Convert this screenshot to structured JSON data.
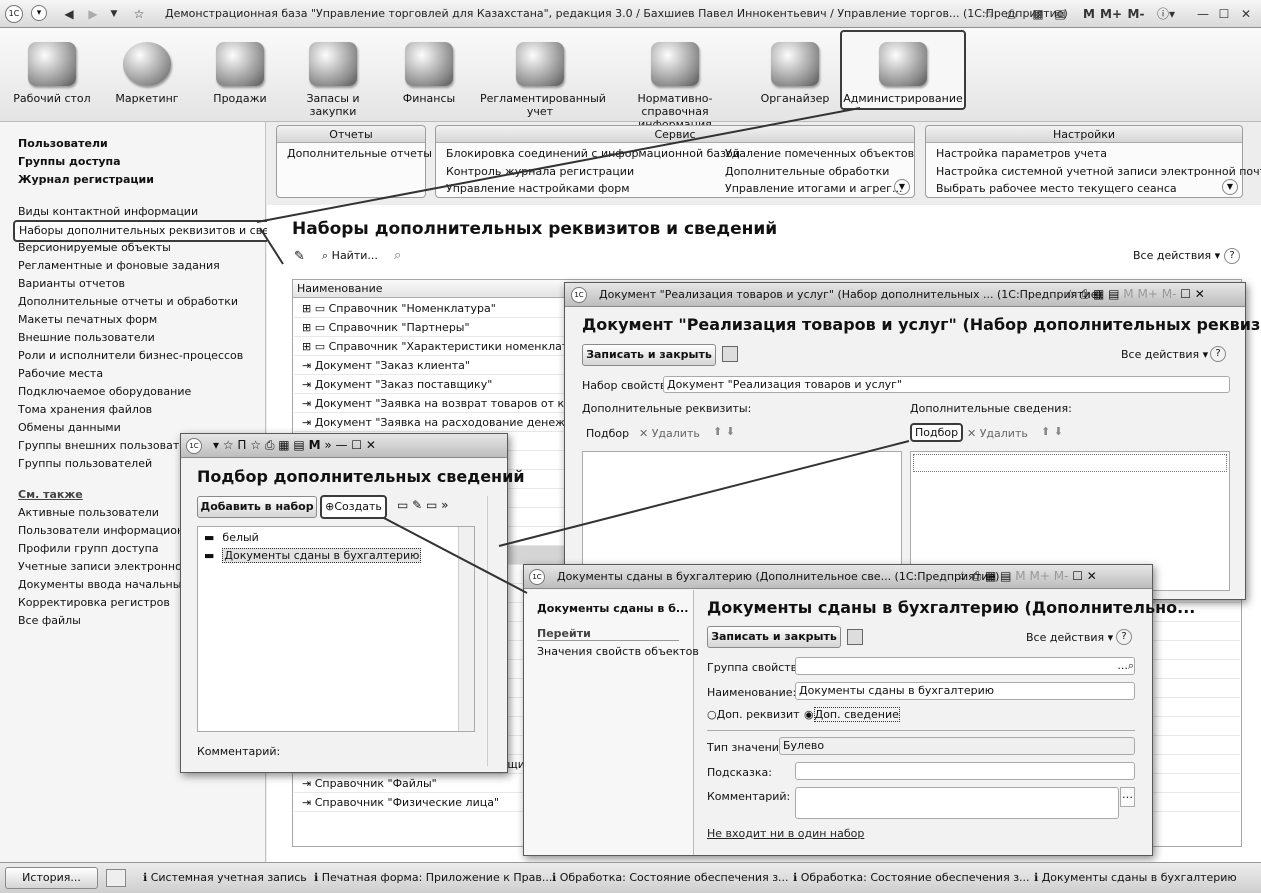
{
  "window": {
    "title": "Демонстрационная база \"Управление торговлей для Казахстана\", редакция 3.0 / Бахшиев Павел Иннокентьевич / Управление торгов...  (1С:Предприятие)",
    "m_buttons": [
      "M",
      "M+",
      "M-"
    ]
  },
  "sections": [
    {
      "label": "Рабочий стол",
      "icon": "desktop-icon"
    },
    {
      "label": "Маркетинг",
      "icon": "pie-chart-icon"
    },
    {
      "label": "Продажи",
      "icon": "truck-icon"
    },
    {
      "label": "Запасы и закупки",
      "icon": "boxes-icon"
    },
    {
      "label": "Финансы",
      "icon": "coins-icon"
    },
    {
      "label": "Регламентированный учет",
      "icon": "document-icon"
    },
    {
      "label": "Нормативно-справочная информация",
      "icon": "binders-icon"
    },
    {
      "label": "Органайзер",
      "icon": "clipboard-icon"
    },
    {
      "label": "Администрирование",
      "icon": "computer-icon"
    }
  ],
  "sidebar": {
    "bold_items": [
      "Пользователи",
      "Группы доступа",
      "Журнал регистрации"
    ],
    "items": [
      "Виды контактной информации",
      "Наборы дополнительных реквизитов и свед...",
      "Версионируемые объекты",
      "Регламентные и фоновые задания",
      "Варианты отчетов",
      "Дополнительные отчеты и обработки",
      "Макеты печатных форм",
      "Внешние пользователи",
      "Роли и исполнители бизнес-процессов",
      "Рабочие места",
      "Подключаемое оборудование",
      "Тома хранения файлов",
      "Обмены данными",
      "Группы внешних пользователей",
      "Группы пользователей"
    ],
    "see_also": "См. также",
    "see_items": [
      "Активные пользователи",
      "Пользователи информационной",
      "Профили групп доступа",
      "Учетные записи электронной п",
      "Документы ввода начальных ос",
      "Корректировка регистров",
      "Все файлы"
    ]
  },
  "panels": {
    "reports": {
      "title": "Отчеты",
      "items": [
        "Дополнительные отчеты"
      ]
    },
    "service": {
      "title": "Сервис",
      "col1": [
        "Блокировка соединений с информационной базой",
        "Контроль журнала регистрации",
        "Управление настройками форм"
      ],
      "col2": [
        "Удаление помеченных объектов",
        "Дополнительные обработки",
        "Управление итогами и агрег..."
      ]
    },
    "settings": {
      "title": "Настройки",
      "items": [
        "Настройка параметров учета",
        "Настройка системной учетной записи электронной почты",
        "Выбрать рабочее место текущего сеанса"
      ]
    }
  },
  "main": {
    "title": "Наборы дополнительных реквизитов и сведений",
    "find": "Найти...",
    "all_actions": "Все действия",
    "col_name": "Наименование",
    "rows": [
      "Справочник \"Номенклатура\"",
      "Справочник \"Партнеры\"",
      "Справочник \"Характеристики номенклатуры\"",
      "Документ \"Заказ клиента\"",
      "Документ \"Заказ поставщику\"",
      "Документ \"Заявка на возврат товаров от кли",
      "Документ \"Заявка на расходование денежн",
      "жение клие",
      "в\"",
      "",
      "",
      "и услуг\"",
      "инвентари",
      "услуг\"",
      "",
      "",
      "",
      "",
      "",
      "",
      "",
      "",
      "тгам",
      "",
      "Справочник \"Условия цен поставщи",
      "Справочник \"Файлы\"",
      "Справочник \"Физические лица\""
    ]
  },
  "doc_window": {
    "title": "Документ \"Реализация товаров и услуг\" (Набор дополнительных ...  (1С:Предприятие)",
    "heading": "Документ \"Реализация товаров и услуг\" (Набор дополнительных реквизито...",
    "save_close": "Записать и закрыть",
    "all_actions": "Все действия",
    "set_label": "Набор свойств:",
    "set_value": "Документ \"Реализация товаров и услуг\"",
    "add_req": "Дополнительные реквизиты:",
    "add_info": "Дополнительные сведения:",
    "pick": "Подбор",
    "delete": "Удалить"
  },
  "pick_window": {
    "title": "П",
    "heading": "Подбор дополнительных сведений",
    "add_btn": "Добавить в набор",
    "create_btn": "Создать",
    "items": [
      "белый",
      "Документы сданы в бухгалтерию"
    ],
    "comment": "Комментарий:"
  },
  "prop_window": {
    "title": "Документы сданы в бухгалтерию (Дополнительное све...  (1С:Предприятие)",
    "nav_title": "Документы сданы в б...",
    "nav_goto": "Перейти",
    "nav_link": "Значения свойств объектов",
    "heading": "Документы сданы в бухгалтерию (Дополнительно...",
    "save_close": "Записать и закрыть",
    "all_actions": "Все действия",
    "group_label": "Группа свойств:",
    "name_label": "Наименование:",
    "name_value": "Документы сданы в бухгалтерию",
    "radio1": "Доп. реквизит",
    "radio2": "Доп. сведение",
    "type_label": "Тип значения:",
    "type_value": "Булево",
    "hint_label": "Подсказка:",
    "comment_label": "Комментарий:",
    "not_in_set": "Не входит ни в один набор"
  },
  "taskbar": {
    "history": "История...",
    "items": [
      "Системная учетная запись",
      "Печатная форма: Приложение к Прав...",
      "Обработка: Состояние обеспечения з...",
      "Обработка: Состояние обеспечения з...",
      "Документы сданы в бухгалтерию"
    ]
  }
}
